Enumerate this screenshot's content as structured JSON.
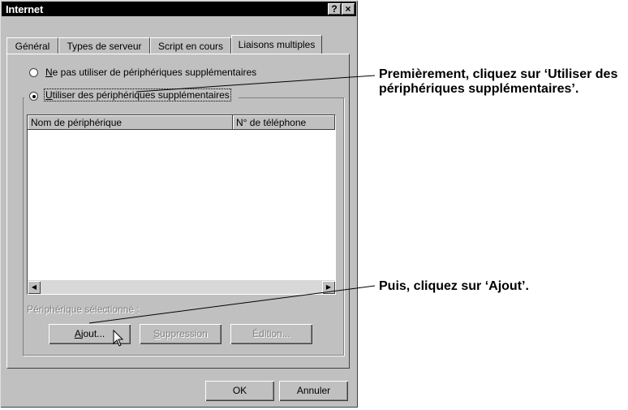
{
  "window": {
    "title": "Internet",
    "help_button": "?",
    "close_button": "×"
  },
  "tabs": [
    {
      "label": "Général"
    },
    {
      "label": "Types de serveur"
    },
    {
      "label": "Script en cours"
    },
    {
      "label": "Liaisons multiples",
      "active": true
    }
  ],
  "options": {
    "no_devices": "Ne pas utiliser de périphériques supplémentaires",
    "use_devices": "Utiliser des périphériques supplémentaires",
    "selected": "use_devices"
  },
  "list": {
    "columns": [
      "Nom de périphérique",
      "N° de téléphone"
    ],
    "rows": []
  },
  "selected_device_label": "Périphérique sélectionné :",
  "buttons": {
    "add": "Ajout...",
    "remove": "Suppression",
    "edit": "Édition...",
    "ok": "OK",
    "cancel": "Annuler"
  },
  "annotations": {
    "first": "Premièrement, cliquez sur ‘Utiliser des périphériques supplémentaires’.",
    "second": "Puis, cliquez sur ‘Ajout’."
  }
}
